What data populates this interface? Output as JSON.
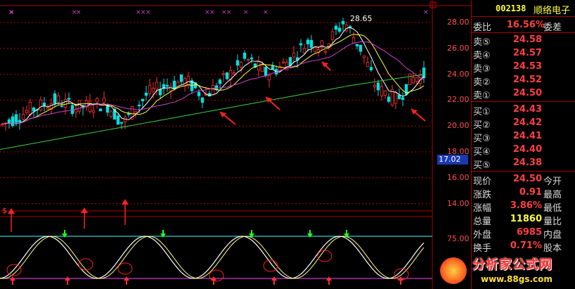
{
  "stock": {
    "code": "002138",
    "name": "顺络电子"
  },
  "price_tag": "17.02",
  "chart_peak_label": "28.65",
  "signal_marker": "$",
  "price_axis": [
    "28.00",
    "26.00",
    "24.00",
    "22.00",
    "20.00",
    "18.00",
    "16.00",
    "14.00"
  ],
  "osc_axis": [
    "75.00"
  ],
  "order_book": {
    "ratio": {
      "label": "委比",
      "value": "16.56%",
      "tail": "委差"
    },
    "sells": [
      {
        "label": "卖⑤",
        "value": "24.58"
      },
      {
        "label": "卖④",
        "value": "24.57"
      },
      {
        "label": "卖③",
        "value": "24.53"
      },
      {
        "label": "卖②",
        "value": "24.52"
      },
      {
        "label": "卖①",
        "value": "24.50"
      }
    ],
    "buys": [
      {
        "label": "买①",
        "value": "24.43"
      },
      {
        "label": "买②",
        "value": "24.42"
      },
      {
        "label": "买③",
        "value": "24.41"
      },
      {
        "label": "买④",
        "value": "24.40"
      },
      {
        "label": "买⑤",
        "value": "24.38"
      }
    ]
  },
  "quote": [
    {
      "label": "现价",
      "value": "24.50",
      "tail": "今开"
    },
    {
      "label": "涨跌",
      "value": "0.91",
      "tail": "最高"
    },
    {
      "label": "涨幅",
      "value": "3.86%",
      "tail": "最低"
    },
    {
      "label": "总量",
      "value": "11860",
      "tail": "量比",
      "yellow": true
    },
    {
      "label": "外盘",
      "value": "6985",
      "tail": "内盘"
    },
    {
      "label": "换手",
      "value": "0.71%",
      "tail": "股本"
    }
  ],
  "watermark": {
    "title": "分析家公式网",
    "url": "www.88gs.com"
  },
  "colors": {
    "bg": "#000000",
    "up": "#ff3030",
    "down": "#00e0e0",
    "ma_white": "#ffffff",
    "ma_yellow": "#ffff40",
    "ma_magenta": "#d040d0",
    "ma_green": "#40d040",
    "grid": "#a00000"
  }
}
